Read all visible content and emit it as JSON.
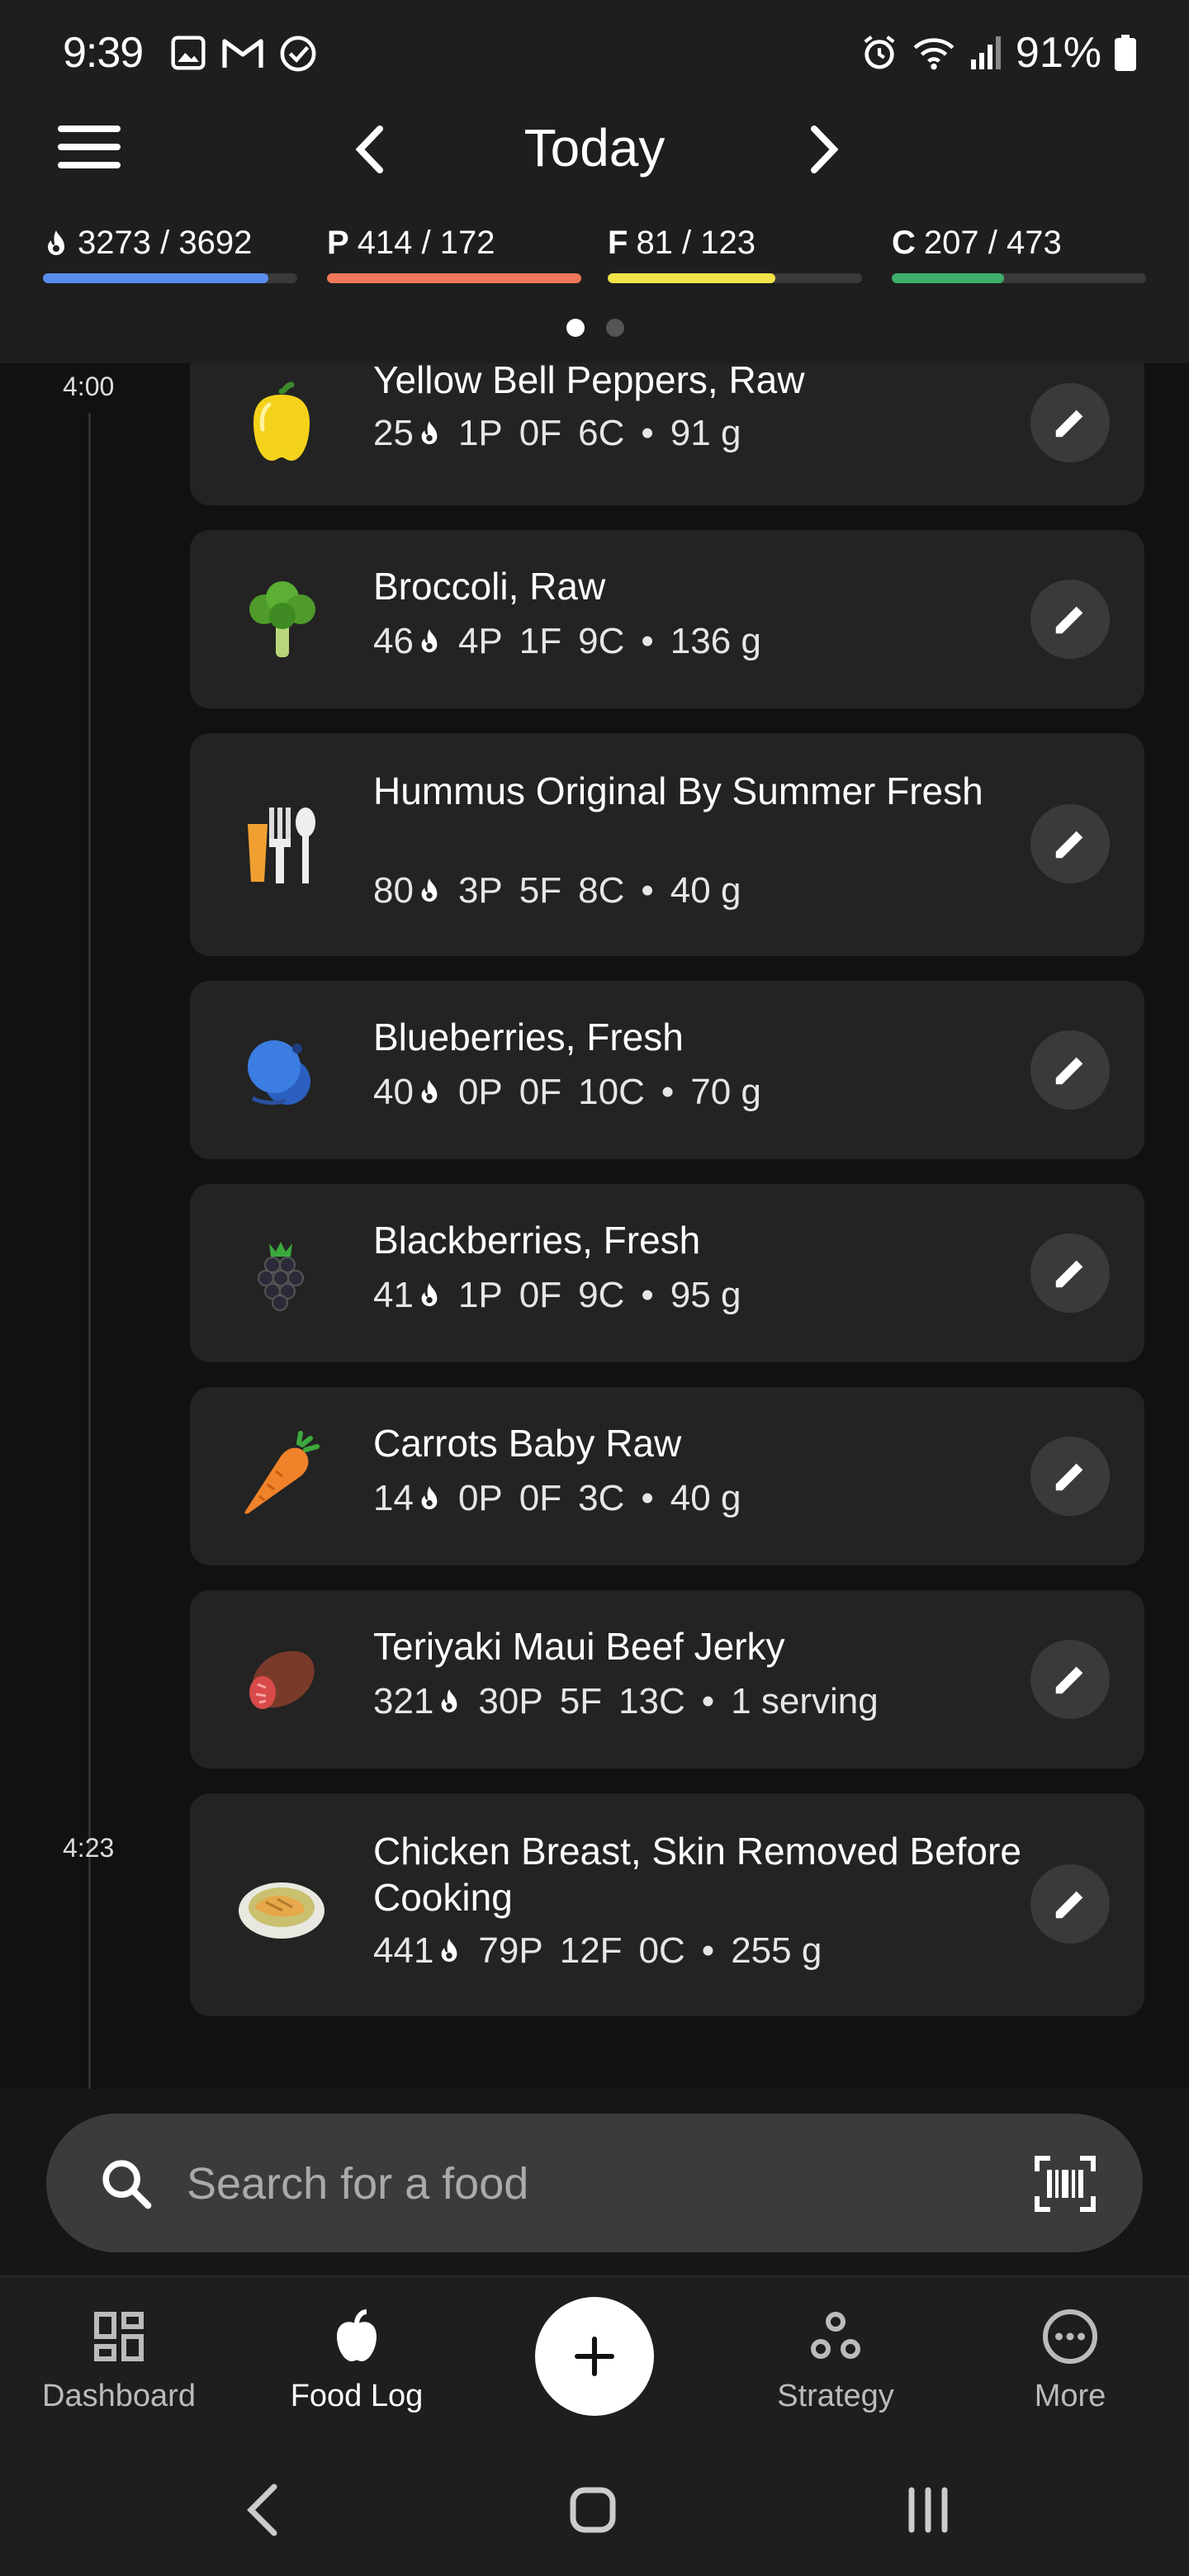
{
  "status": {
    "time": "9:39",
    "battery": "91%"
  },
  "header": {
    "date_title": "Today",
    "macros": {
      "energy": {
        "value": "3273 / 3692",
        "progress": 0.886,
        "color": "#5b8def"
      },
      "protein": {
        "letter": "P",
        "value": "414 / 172",
        "progress": 1.0,
        "color": "#f0785a"
      },
      "fat": {
        "letter": "F",
        "value": "81 / 123",
        "progress": 0.66,
        "color": "#f2e44a"
      },
      "carbs": {
        "letter": "C",
        "value": "207 / 473",
        "progress": 0.44,
        "color": "#3fae6a"
      }
    }
  },
  "timeline": {
    "times": [
      "4:00",
      "4:23"
    ]
  },
  "foods": [
    {
      "name": "Yellow Bell Peppers, Raw",
      "cal": "25",
      "p": "1P",
      "f": "0F",
      "c": "6C",
      "amount": "91 g",
      "icon": "bell-pepper-icon"
    },
    {
      "name": "Broccoli, Raw",
      "cal": "46",
      "p": "4P",
      "f": "1F",
      "c": "9C",
      "amount": "136 g",
      "icon": "broccoli-icon"
    },
    {
      "name": "Hummus Original By Summer Fresh",
      "cal": "80",
      "p": "3P",
      "f": "5F",
      "c": "8C",
      "amount": "40 g",
      "icon": "fork-spoon-icon"
    },
    {
      "name": "Blueberries, Fresh",
      "cal": "40",
      "p": "0P",
      "f": "0F",
      "c": "10C",
      "amount": "70 g",
      "icon": "blueberries-icon"
    },
    {
      "name": "Blackberries, Fresh",
      "cal": "41",
      "p": "1P",
      "f": "0F",
      "c": "9C",
      "amount": "95 g",
      "icon": "blackberry-icon"
    },
    {
      "name": "Carrots Baby Raw",
      "cal": "14",
      "p": "0P",
      "f": "0F",
      "c": "3C",
      "amount": "40 g",
      "icon": "carrot-icon"
    },
    {
      "name": "Teriyaki Maui Beef Jerky",
      "cal": "321",
      "p": "30P",
      "f": "5F",
      "c": "13C",
      "amount": "1 serving",
      "icon": "beef-icon"
    },
    {
      "name": "Chicken Breast, Skin Removed Before Cooking",
      "cal": "441",
      "p": "79P",
      "f": "12F",
      "c": "0C",
      "amount": "255 g",
      "icon": "chicken-plate-icon"
    }
  ],
  "search": {
    "placeholder": "Search for a food"
  },
  "bottom_nav": {
    "dashboard": "Dashboard",
    "food_log": "Food Log",
    "strategy": "Strategy",
    "more": "More"
  },
  "separator": "•"
}
